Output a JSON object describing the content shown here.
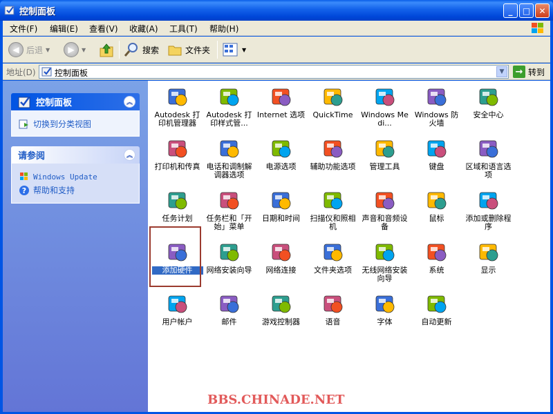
{
  "window": {
    "title": "控制面板",
    "min_glyph": "_",
    "max_glyph": "□",
    "close_glyph": "✕"
  },
  "menu": [
    "文件(F)",
    "编辑(E)",
    "查看(V)",
    "收藏(A)",
    "工具(T)",
    "帮助(H)"
  ],
  "toolbar": {
    "back": "后退",
    "search": "搜索",
    "folders": "文件夹"
  },
  "address": {
    "label": "地址(D)",
    "value": "控制面板",
    "go": "转到"
  },
  "leftpane": {
    "panel1": {
      "title": "控制面板",
      "link": "切换到分类视图"
    },
    "panel2": {
      "title": "请参阅",
      "links": [
        "Windows Update",
        "帮助和支持"
      ]
    }
  },
  "items": [
    {
      "label": "Autodesk 打印机管理器",
      "icon": "printer-manager-icon"
    },
    {
      "label": "Autodesk 打印样式管...",
      "icon": "plot-style-icon"
    },
    {
      "label": "Internet 选项",
      "icon": "internet-options-icon"
    },
    {
      "label": "QuickTime",
      "icon": "quicktime-icon"
    },
    {
      "label": "Windows Medi...",
      "icon": "windows-media-icon"
    },
    {
      "label": "Windows 防火墙",
      "icon": "firewall-icon"
    },
    {
      "label": "安全中心",
      "icon": "security-center-icon"
    },
    {
      "label": "打印机和传真",
      "icon": "printers-fax-icon"
    },
    {
      "label": "电话和调制解调器选项",
      "icon": "phone-modem-icon"
    },
    {
      "label": "电源选项",
      "icon": "power-options-icon"
    },
    {
      "label": "辅助功能选项",
      "icon": "accessibility-icon"
    },
    {
      "label": "管理工具",
      "icon": "admin-tools-icon"
    },
    {
      "label": "键盘",
      "icon": "keyboard-icon"
    },
    {
      "label": "区域和语言选项",
      "icon": "region-language-icon"
    },
    {
      "label": "任务计划",
      "icon": "scheduled-tasks-icon"
    },
    {
      "label": "任务栏和「开始」菜单",
      "icon": "taskbar-start-icon"
    },
    {
      "label": "日期和时间",
      "icon": "date-time-icon"
    },
    {
      "label": "扫描仪和照相机",
      "icon": "scanner-camera-icon"
    },
    {
      "label": "声音和音频设备",
      "icon": "sound-audio-icon"
    },
    {
      "label": "鼠标",
      "icon": "mouse-icon"
    },
    {
      "label": "添加或删除程序",
      "icon": "add-remove-programs-icon"
    },
    {
      "label": "添加硬件",
      "icon": "add-hardware-icon",
      "selected": true
    },
    {
      "label": "网络安装向导",
      "icon": "network-setup-icon"
    },
    {
      "label": "网络连接",
      "icon": "network-connections-icon"
    },
    {
      "label": "文件夹选项",
      "icon": "folder-options-icon"
    },
    {
      "label": "无线网络安装向导",
      "icon": "wireless-setup-icon"
    },
    {
      "label": "系统",
      "icon": "system-icon"
    },
    {
      "label": "显示",
      "icon": "display-icon"
    },
    {
      "label": "用户帐户",
      "icon": "user-accounts-icon"
    },
    {
      "label": "邮件",
      "icon": "mail-icon"
    },
    {
      "label": "游戏控制器",
      "icon": "game-controllers-icon"
    },
    {
      "label": "语音",
      "icon": "speech-icon"
    },
    {
      "label": "字体",
      "icon": "fonts-icon"
    },
    {
      "label": "自动更新",
      "icon": "automatic-updates-icon"
    }
  ],
  "watermark": "BBS.CHINADE.NET",
  "colors": {
    "selection": "#316ac5",
    "xp_blue": "#0054e3",
    "link": "#215dc6"
  }
}
